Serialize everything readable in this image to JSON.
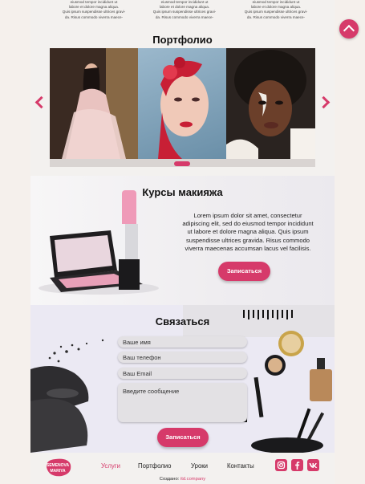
{
  "top_snippets": [
    {
      "line1": "eiusmod tempor incididunt ut",
      "line2": "labore et dolore magna aliqua.",
      "line3": "Quis ipsum suspendisse ultrices gravi-",
      "line4": "da. Risus commodo viverra maece-"
    },
    {
      "line1": "eiusmod tempor incididunt ut",
      "line2": "labore et dolore magna aliqua.",
      "line3": "Quis ipsum suspendisse ultrices gravi-",
      "line4": "da. Risus commodo viverra maece-"
    },
    {
      "line1": "eiusmod tempor incididunt ut",
      "line2": "labore et dolore magna aliqua.",
      "line3": "Quis ipsum suspendisse ultrices gravi-",
      "line4": "da. Risus commodo viverra maece-"
    }
  ],
  "portfolio": {
    "title": "Портфолио",
    "photos": [
      "woman-in-pink-dress",
      "woman-with-red-floral-makeup",
      "woman-with-white-face-art"
    ]
  },
  "courses": {
    "title": "Курсы макияжа",
    "text": "Lorem ipsum dolor sit amet, consectetur adipiscing elit, sed do eiusmod tempor incididunt ut labore et dolore magna aliqua. Quis ipsum suspendisse ultrices gravida. Risus commodo viverra maecenas accumsan lacus vel facilisis.",
    "button": "Записаться"
  },
  "contact": {
    "title": "Связаться",
    "name_placeholder": "Ваше имя",
    "phone_placeholder": "Ваш телефон",
    "email_placeholder": "Ваш Email",
    "message_placeholder": "Введите сообщение",
    "button": "Записаться"
  },
  "footer": {
    "logo_line1": "SEMENOVA",
    "logo_line2": "MARIYA",
    "nav": [
      "Услуги",
      "Портфолио",
      "Уроки",
      "Контакты"
    ],
    "credit_prefix": "Создано:",
    "credit_link": "itd.company"
  },
  "colors": {
    "accent": "#d63a6a",
    "field": "#e3e1e4",
    "page": "#f3f1ef"
  },
  "icons": [
    "scroll-up-icon",
    "instagram-icon",
    "facebook-icon",
    "vk-icon"
  ]
}
